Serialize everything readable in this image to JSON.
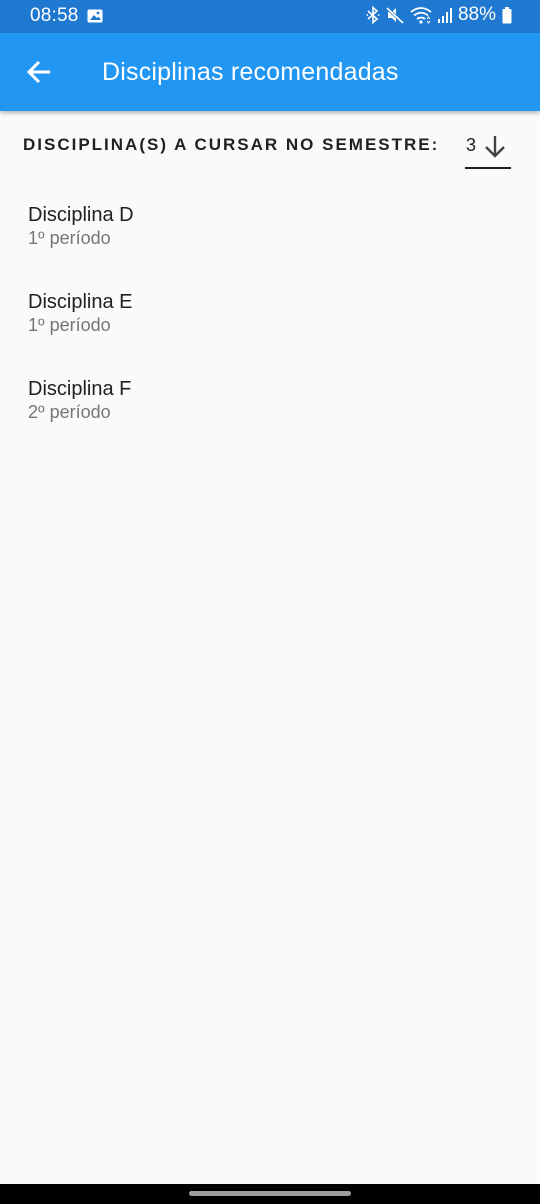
{
  "status_bar": {
    "time": "08:58",
    "battery": "88%",
    "icons": [
      "image-icon",
      "bluetooth-icon",
      "mute-icon",
      "wifi-icon",
      "signal-icon",
      "battery-icon"
    ]
  },
  "app_bar": {
    "title": "Disciplinas recomendadas",
    "back_icon": "arrow-back-icon",
    "color": "#2196f3",
    "status_color": "#1f79d0"
  },
  "semester": {
    "label": "DISCIPLINA(S) A CURSAR NO SEMESTRE:",
    "value": "3",
    "dropdown_icon": "arrow-down-icon"
  },
  "courses": [
    {
      "name": "Disciplina D",
      "period": "1º período"
    },
    {
      "name": "Disciplina E",
      "period": "1º período"
    },
    {
      "name": "Disciplina F",
      "period": "2º período"
    }
  ]
}
